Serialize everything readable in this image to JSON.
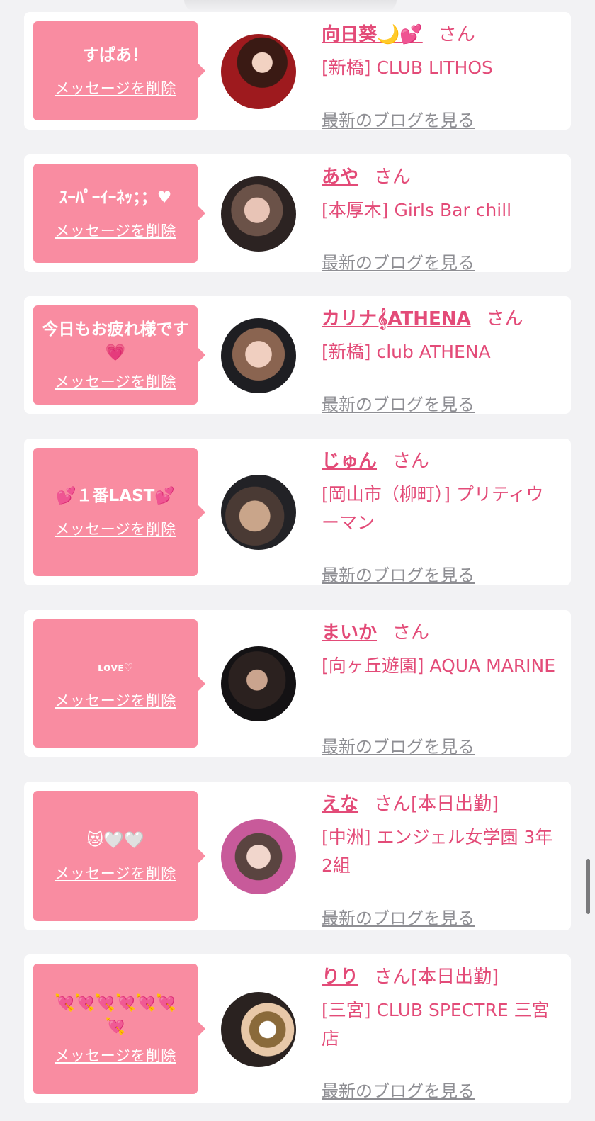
{
  "messages": [
    {
      "message": "すぱあ！",
      "delete_label": "メッセージを削除",
      "name": "向日葵🌙💕",
      "honorific": "さん",
      "status": "",
      "shop": "[新橋] CLUB LITHOS",
      "blog_label": "最新のブログを見る"
    },
    {
      "message": "ｽｰﾊﾟｰｲｰﾈｯ；；♥",
      "delete_label": "メッセージを削除",
      "name": "あや",
      "honorific": "さん",
      "status": "",
      "shop": "[本厚木] Girls Bar chill",
      "blog_label": "最新のブログを見る"
    },
    {
      "message": "今日もお疲れ様です💗",
      "delete_label": "メッセージを削除",
      "name": "カリナ𝄞ATHENA",
      "honorific": "さん",
      "status": "",
      "shop": "[新橋] club ATHENA",
      "blog_label": "最新のブログを見る"
    },
    {
      "message": "💕１番LAST💕",
      "delete_label": "メッセージを削除",
      "name": "じゅん",
      "honorific": "さん",
      "status": "",
      "shop": "[岡山市（柳町）] プリティウーマン",
      "blog_label": "最新のブログを見る"
    },
    {
      "message": "ʟᴏᴠᴇ♡",
      "delete_label": "メッセージを削除",
      "name": "まいか",
      "honorific": "さん",
      "status": "",
      "shop": "[向ヶ丘遊園] AQUA MARINE",
      "blog_label": "最新のブログを見る"
    },
    {
      "message": "😻🤍🤍",
      "delete_label": "メッセージを削除",
      "name": "えな",
      "honorific": "さん",
      "status": "[本日出勤]",
      "shop": "[中洲] エンジェル女学園 3年2組",
      "blog_label": "最新のブログを見る"
    },
    {
      "message": "💘💘💘💘💘💘💘",
      "delete_label": "メッセージを削除",
      "name": "りり",
      "honorific": "さん",
      "status": "[本日出勤]",
      "shop": "[三宮] CLUB SPECTRE 三宮店",
      "blog_label": "最新のブログを見る"
    }
  ],
  "colors": {
    "bubble": "#f98ca1",
    "accent_text": "#e34b78",
    "link_gray": "#8e8e93",
    "card_bg": "#ffffff",
    "page_bg": "#f2f2f4"
  }
}
